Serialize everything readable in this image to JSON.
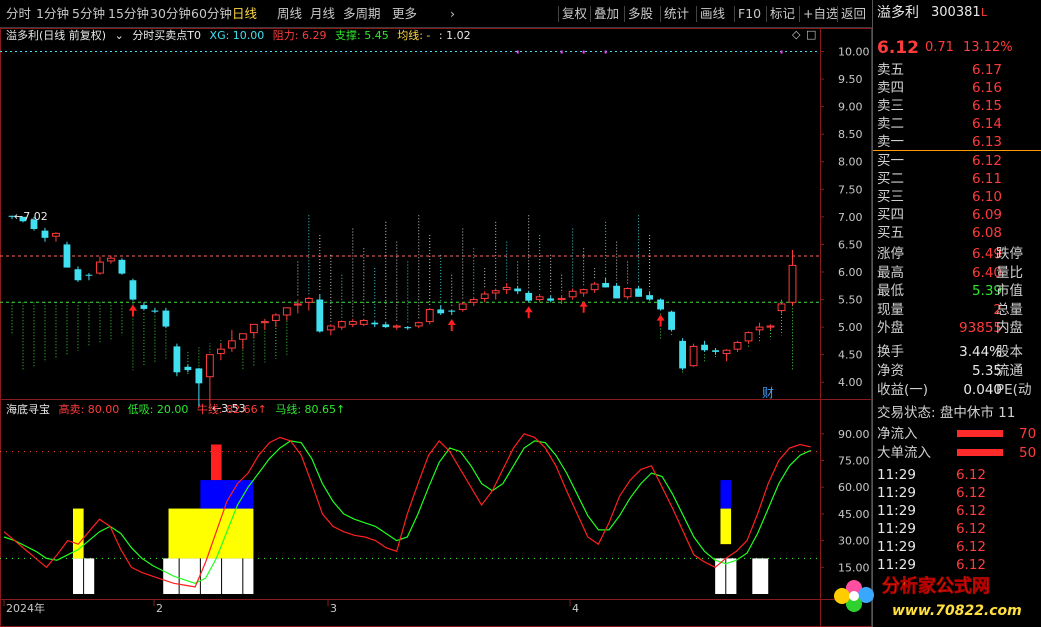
{
  "toolbar": {
    "left_items": [
      {
        "label": "分时",
        "active": false
      },
      {
        "label": "1分钟",
        "active": false
      },
      {
        "label": "5分钟",
        "active": false
      },
      {
        "label": "15分钟",
        "active": false
      },
      {
        "label": "30分钟",
        "active": false
      },
      {
        "label": "60分钟",
        "active": false
      },
      {
        "label": "日线",
        "active": true
      },
      {
        "label": "周线",
        "active": false
      },
      {
        "label": "月线",
        "active": false
      },
      {
        "label": "多周期",
        "active": false
      },
      {
        "label": "更多",
        "active": false
      }
    ],
    "right_items": [
      "复权",
      "叠加",
      "多股",
      "统计",
      "画线",
      "F10",
      "标记",
      "+自选",
      "返回"
    ]
  },
  "main_legend": {
    "stock": "溢多利(日线 前复权)",
    "indicator": "分时买卖点T0",
    "xg": "XG: 10.00",
    "resistance": "阻力: 6.29",
    "support": "支撑: 5.45",
    "avg_line": "均线: -",
    "colon_value": ": 1.02"
  },
  "sub_legend": {
    "name": "海底寻宝",
    "high_sell": "高卖: 80.00",
    "low_buy": "低吸: 20.00",
    "bull_line": "牛线: 82.66↑",
    "horse_line": "马线: 80.65↑"
  },
  "main_axis": {
    "ticks": [
      "10.00",
      "9.50",
      "9.00",
      "8.50",
      "8.00",
      "7.50",
      "7.00",
      "6.50",
      "6.00",
      "5.50",
      "5.00",
      "4.50",
      "4.00"
    ]
  },
  "sub_axis": {
    "ticks": [
      "90.00",
      "75.00",
      "60.00",
      "45.00",
      "30.00",
      "15.00"
    ]
  },
  "date_labels": [
    "2024年",
    "2",
    "3",
    "4"
  ],
  "annotations": {
    "high": "←7.02",
    "low": "←3.53",
    "cai": "财"
  },
  "chart_data": [
    {
      "type": "candlestick",
      "title": "溢多利(日线 前复权)",
      "resistance": 6.29,
      "support": 5.45,
      "xg": 10.0,
      "ylim": [
        3.75,
        10.1
      ],
      "candles": [
        [
          7.02,
          7.02,
          6.96,
          7.0
        ],
        [
          7.0,
          7.0,
          6.9,
          6.92
        ],
        [
          6.95,
          7.0,
          6.75,
          6.78
        ],
        [
          6.75,
          6.8,
          6.55,
          6.62
        ],
        [
          6.65,
          6.72,
          6.55,
          6.7
        ],
        [
          6.5,
          6.55,
          6.1,
          6.08
        ],
        [
          6.05,
          6.1,
          5.82,
          5.85
        ],
        [
          5.95,
          5.98,
          5.85,
          5.94
        ],
        [
          5.98,
          6.28,
          5.95,
          6.18
        ],
        [
          6.2,
          6.3,
          6.15,
          6.25
        ],
        [
          6.22,
          6.25,
          5.95,
          5.97
        ],
        [
          5.85,
          5.88,
          5.48,
          5.5
        ],
        [
          5.4,
          5.45,
          5.3,
          5.33
        ],
        [
          5.3,
          5.35,
          5.25,
          5.28
        ],
        [
          5.3,
          5.35,
          4.98,
          5.01
        ],
        [
          4.65,
          4.7,
          4.12,
          4.18
        ],
        [
          4.28,
          4.32,
          4.18,
          4.22
        ],
        [
          4.25,
          4.26,
          3.55,
          3.98
        ],
        [
          4.1,
          4.12,
          3.53,
          4.5
        ],
        [
          4.52,
          4.7,
          4.4,
          4.6
        ],
        [
          4.62,
          4.95,
          4.55,
          4.75
        ],
        [
          4.78,
          4.88,
          4.6,
          4.88
        ],
        [
          4.9,
          5.05,
          4.8,
          5.05
        ],
        [
          5.08,
          5.15,
          4.95,
          5.1
        ],
        [
          5.12,
          5.25,
          5.0,
          5.22
        ],
        [
          5.22,
          5.35,
          5.12,
          5.35
        ],
        [
          5.4,
          5.5,
          5.25,
          5.42
        ],
        [
          5.45,
          5.55,
          5.3,
          5.52
        ],
        [
          5.5,
          5.6,
          4.9,
          4.92
        ],
        [
          4.95,
          5.05,
          4.85,
          5.02
        ],
        [
          5.0,
          5.12,
          4.95,
          5.1
        ],
        [
          5.05,
          5.15,
          5.0,
          5.1
        ],
        [
          5.05,
          5.15,
          5.02,
          5.12
        ],
        [
          5.08,
          5.12,
          5.0,
          5.05
        ],
        [
          5.05,
          5.1,
          4.98,
          5.0
        ],
        [
          5.0,
          5.05,
          4.95,
          5.02
        ],
        [
          5.0,
          5.02,
          4.95,
          4.98
        ],
        [
          5.02,
          5.1,
          4.98,
          5.08
        ],
        [
          5.1,
          5.35,
          5.05,
          5.32
        ],
        [
          5.32,
          5.4,
          5.22,
          5.25
        ],
        [
          5.3,
          5.32,
          5.22,
          5.28
        ],
        [
          5.32,
          5.45,
          5.28,
          5.42
        ],
        [
          5.45,
          5.55,
          5.38,
          5.5
        ],
        [
          5.52,
          5.65,
          5.45,
          5.6
        ],
        [
          5.62,
          5.7,
          5.5,
          5.66
        ],
        [
          5.68,
          5.8,
          5.6,
          5.72
        ],
        [
          5.7,
          5.75,
          5.6,
          5.65
        ],
        [
          5.62,
          5.66,
          5.45,
          5.48
        ],
        [
          5.5,
          5.6,
          5.45,
          5.55
        ],
        [
          5.52,
          5.58,
          5.45,
          5.48
        ],
        [
          5.5,
          5.58,
          5.42,
          5.52
        ],
        [
          5.55,
          5.7,
          5.5,
          5.65
        ],
        [
          5.62,
          5.7,
          5.55,
          5.68
        ],
        [
          5.68,
          5.82,
          5.62,
          5.78
        ],
        [
          5.8,
          5.9,
          5.72,
          5.72
        ],
        [
          5.75,
          5.8,
          5.55,
          5.52
        ],
        [
          5.55,
          5.72,
          5.5,
          5.7
        ],
        [
          5.7,
          5.75,
          5.55,
          5.55
        ],
        [
          5.58,
          5.65,
          5.48,
          5.5
        ],
        [
          5.5,
          5.52,
          5.3,
          5.32
        ],
        [
          5.28,
          5.3,
          4.92,
          4.95
        ],
        [
          4.75,
          4.8,
          4.22,
          4.25
        ],
        [
          4.3,
          4.7,
          4.28,
          4.65
        ],
        [
          4.68,
          4.75,
          4.55,
          4.58
        ],
        [
          4.58,
          4.62,
          4.5,
          4.55
        ],
        [
          4.52,
          4.6,
          4.38,
          4.58
        ],
        [
          4.6,
          4.75,
          4.55,
          4.72
        ],
        [
          4.75,
          4.92,
          4.7,
          4.9
        ],
        [
          4.95,
          5.08,
          4.88,
          5.0
        ],
        [
          5.0,
          5.05,
          4.95,
          5.02
        ],
        [
          5.3,
          5.5,
          5.25,
          5.42
        ],
        [
          5.45,
          6.4,
          5.39,
          6.12
        ]
      ]
    },
    {
      "type": "line",
      "title": "海底寻宝",
      "ylim": [
        0,
        100
      ],
      "series": [
        {
          "name": "牛线",
          "values": [
            35,
            30,
            25,
            20,
            15,
            22,
            30,
            28,
            35,
            42,
            38,
            25,
            15,
            12,
            10,
            8,
            6,
            5,
            4,
            18,
            35,
            52,
            62,
            68,
            78,
            85,
            88,
            86,
            78,
            62,
            45,
            38,
            35,
            33,
            32,
            30,
            26,
            24,
            45,
            62,
            78,
            86,
            80,
            70,
            60,
            50,
            58,
            70,
            82,
            90,
            88,
            82,
            72,
            58,
            45,
            32,
            28,
            40,
            55,
            64,
            70,
            72,
            60,
            48,
            35,
            22,
            18,
            15,
            20,
            24,
            30,
            45,
            62,
            75,
            82,
            84,
            82.66
          ]
        },
        {
          "name": "马线",
          "values": [
            32,
            30,
            27,
            24,
            20,
            19,
            22,
            25,
            30,
            35,
            38,
            34,
            26,
            20,
            16,
            13,
            10,
            8,
            6,
            9,
            20,
            35,
            50,
            60,
            68,
            76,
            82,
            86,
            85,
            76,
            62,
            52,
            45,
            42,
            40,
            38,
            34,
            30,
            32,
            45,
            60,
            74,
            82,
            80,
            72,
            62,
            58,
            62,
            72,
            82,
            86,
            85,
            78,
            68,
            56,
            44,
            36,
            36,
            44,
            54,
            62,
            68,
            66,
            56,
            44,
            32,
            24,
            19,
            17,
            19,
            23,
            34,
            48,
            62,
            72,
            78,
            80.65
          ]
        }
      ]
    }
  ],
  "quote": {
    "name": "溢多利",
    "code": "300381",
    "flag": "L",
    "price": "6.12",
    "change": "0.71",
    "change_pct": "13.12%",
    "sell": [
      {
        "label": "卖五",
        "price": "6.17"
      },
      {
        "label": "卖四",
        "price": "6.16"
      },
      {
        "label": "卖三",
        "price": "6.15"
      },
      {
        "label": "卖二",
        "price": "6.14"
      },
      {
        "label": "卖一",
        "price": "6.13"
      }
    ],
    "buy": [
      {
        "label": "买一",
        "price": "6.12"
      },
      {
        "label": "买二",
        "price": "6.11"
      },
      {
        "label": "买三",
        "price": "6.10"
      },
      {
        "label": "买四",
        "price": "6.09"
      },
      {
        "label": "买五",
        "price": "6.08"
      }
    ],
    "stats": [
      {
        "label": "涨停",
        "value": "6.49",
        "color": "red",
        "right": "跌停"
      },
      {
        "label": "最高",
        "value": "6.40",
        "color": "red",
        "right": "量比"
      },
      {
        "label": "最低",
        "value": "5.39",
        "color": "green",
        "right": "市值"
      },
      {
        "label": "现量",
        "value": "2",
        "color": "red",
        "right": "总量"
      },
      {
        "label": "外盘",
        "value": "93855",
        "color": "red",
        "right": "内盘"
      }
    ],
    "finance": [
      {
        "label": "换手",
        "value": "3.44%",
        "right": "股本"
      },
      {
        "label": "净资",
        "value": "5.35",
        "right": "流通"
      },
      {
        "label": "收益(一)",
        "value": "0.040",
        "right": "PE(动"
      }
    ],
    "trade_status": "交易状态: 盘中休市 11",
    "net_inflow_label": "净流入",
    "net_inflow_value": "70",
    "big_inflow_label": "大单流入",
    "big_inflow_value": "50",
    "ticks": [
      {
        "time": "11:29",
        "price": "6.12"
      },
      {
        "time": "11:29",
        "price": "6.12"
      },
      {
        "time": "11:29",
        "price": "6.12"
      },
      {
        "time": "11:29",
        "price": "6.12"
      },
      {
        "time": "11:29",
        "price": "6.12"
      },
      {
        "time": "11:29",
        "price": "6.12"
      }
    ]
  },
  "watermark": {
    "text": "分析家公式网",
    "url": "www.70822.com"
  },
  "colors": {
    "up": "#ff3c3c",
    "down": "#40e0f0",
    "resistance": "#ff6464",
    "support": "#40e040",
    "bull": "#ff2020",
    "horse": "#20ff20",
    "yellow": "#ffff00",
    "blue": "#0000ff",
    "grid": "#8a1b1b"
  }
}
